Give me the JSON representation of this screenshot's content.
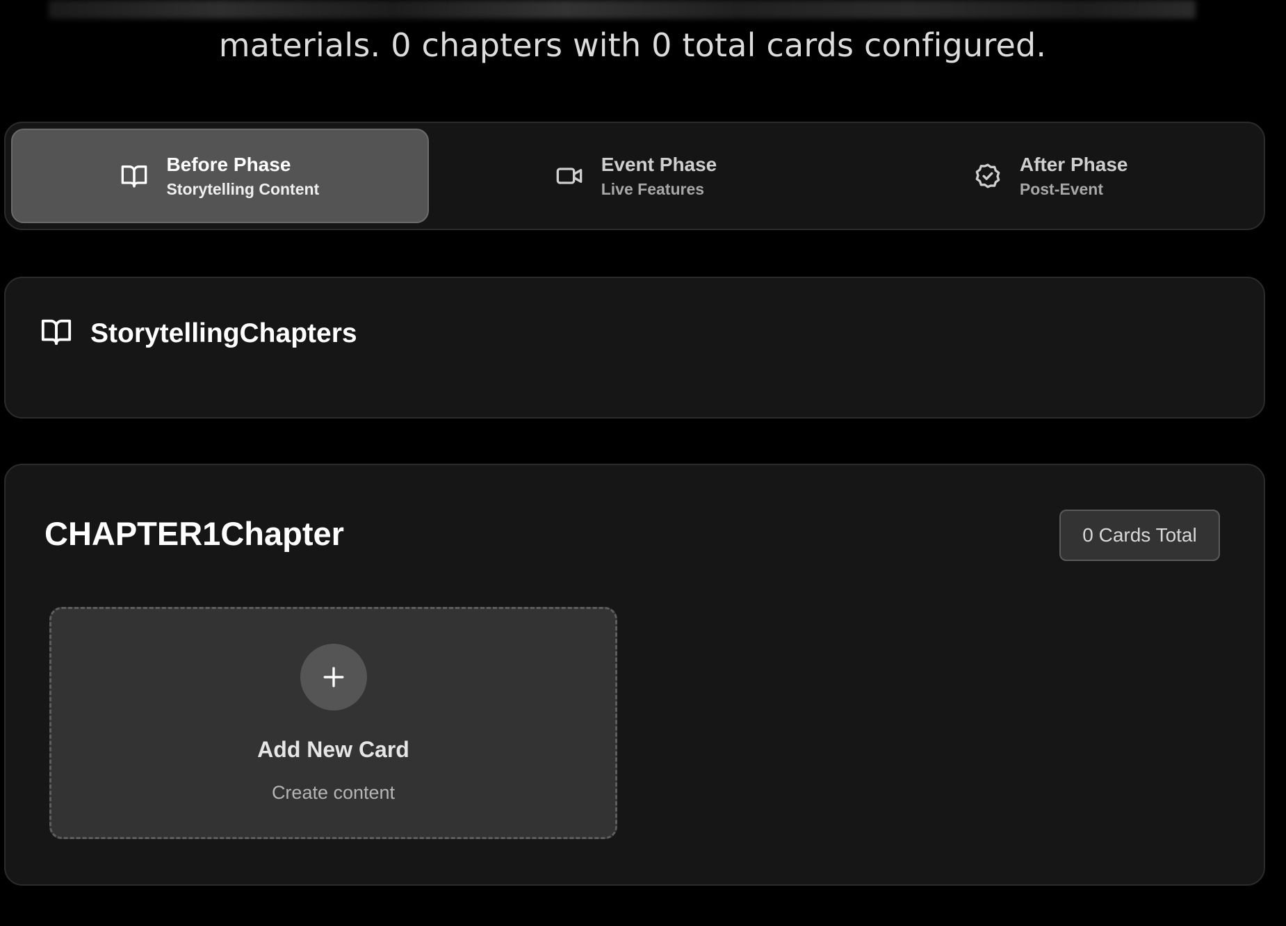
{
  "intro": {
    "text": "materials. 0 chapters with 0 total cards configured."
  },
  "phases": [
    {
      "title": "Before Phase",
      "subtitle": "Storytelling Content",
      "icon": "book-open-icon",
      "active": true
    },
    {
      "title": "Event Phase",
      "subtitle": "Live Features",
      "icon": "video-camera-icon",
      "active": false
    },
    {
      "title": "After Phase",
      "subtitle": "Post-Event",
      "icon": "check-badge-icon",
      "active": false
    }
  ],
  "storytelling": {
    "title": "StorytellingChapters",
    "icon": "book-open-icon"
  },
  "chapter": {
    "title": "CHAPTER1Chapter",
    "cards_badge": "0 Cards Total",
    "add_card": {
      "title": "Add New Card",
      "subtitle": "Create content",
      "icon": "plus-icon"
    }
  },
  "colors": {
    "background": "#000000",
    "panel": "#161616",
    "active_tab": "#545454",
    "add_card": "#333333"
  }
}
